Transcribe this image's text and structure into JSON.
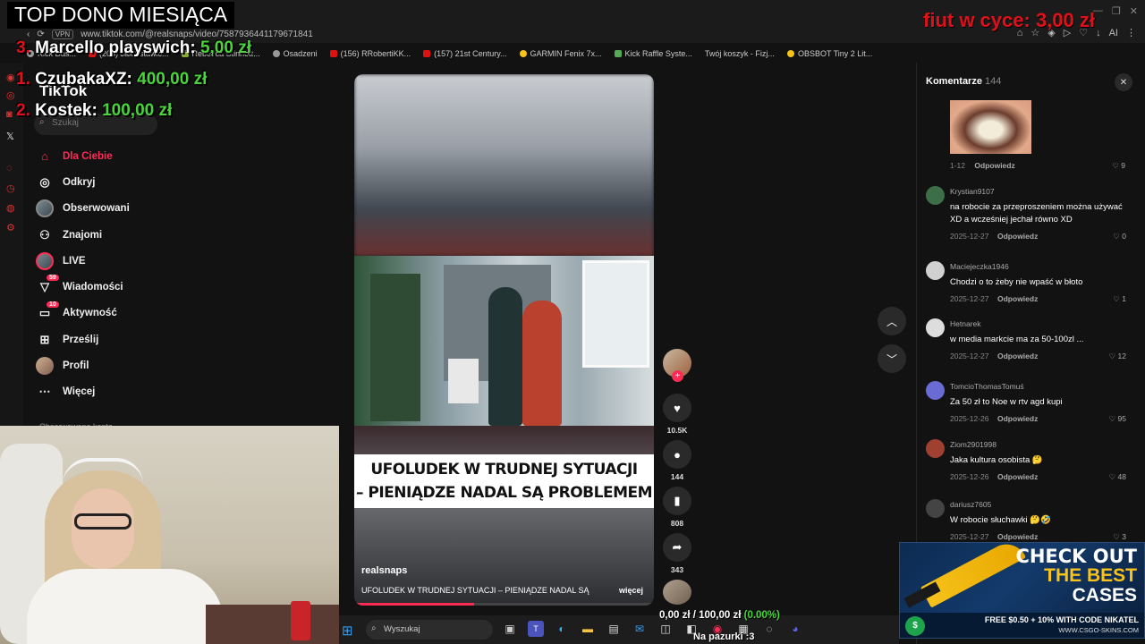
{
  "browser": {
    "url": "www.tiktok.com/@realsnaps/video/7587936441179671841",
    "vpn_label": "VPN",
    "bookmarks": [
      "Marcello playswich:",
      "Kick Das...",
      "(206) Jak ustawić...",
      "Rebecca Stinnett...",
      "Osadzeni",
      "(156) RRobertiKK...",
      "(157) 21st Century...",
      "GARMIN Fenix 7x...",
      "Kick Raffle Syste...",
      "Twój koszyk - Fizj...",
      "OBSBOT Tiny 2 Lit..."
    ],
    "ai_label": "AI"
  },
  "overlay": {
    "top_title": "TOP DONO MIESIĄCA",
    "donors": [
      {
        "rank": "3.",
        "name": "Marcello playswich:",
        "amount": "5,00 zł"
      },
      {
        "rank": "1.",
        "name": "CzubakaXZ:",
        "amount": "400,00 zł"
      },
      {
        "rank": "2.",
        "name": "Kostek:",
        "amount": "100,00 zł"
      }
    ],
    "goal_title": "fiut w cyce:",
    "goal_amount": "3,00 zł",
    "goal_progress": "0,00 zł / 100,00 zł",
    "goal_percent": "(0.00%)",
    "pazurki": "Na pazurki :3"
  },
  "sidebar": {
    "logo": "TikTok",
    "search_placeholder": "Szukaj",
    "items": [
      {
        "label": "Dla Ciebie",
        "icon": "home-icon",
        "active": true
      },
      {
        "label": "Odkryj",
        "icon": "compass-icon"
      },
      {
        "label": "Obserwowani",
        "icon": "following-avatar-icon"
      },
      {
        "label": "Znajomi",
        "icon": "friends-icon"
      },
      {
        "label": "LIVE",
        "icon": "live-avatar-icon"
      },
      {
        "label": "Wiadomości",
        "icon": "messages-icon",
        "badge": "59"
      },
      {
        "label": "Aktywność",
        "icon": "activity-icon",
        "badge": "10"
      },
      {
        "label": "Prześlij",
        "icon": "upload-icon"
      },
      {
        "label": "Profil",
        "icon": "profile-avatar-icon"
      },
      {
        "label": "Więcej",
        "icon": "more-icon"
      }
    ],
    "followed_accounts_label": "Obserwowane konta"
  },
  "video": {
    "banner_line1": "UFOLUDEK W TRUDNEJ SYTUACJI",
    "banner_line2": "– PIENIĄDZE NADAL SĄ PROBLEMEM",
    "username": "realsnaps",
    "description": "UFOLUDEK W TRUDNEJ SYTUACJI – PIENIĄDZE NADAL SĄ",
    "more": "więcej",
    "likes": "10.5K",
    "comments": "144",
    "saves": "808",
    "shares": "343"
  },
  "comments": {
    "title": "Komentarze",
    "count": "144",
    "top_item": {
      "date": "1-12",
      "reply": "Odpowiedz",
      "likes": "9"
    },
    "items": [
      {
        "user": "Krystian9107",
        "text": "na robocie za przeproszeniem można używać XD a wcześniej jechał równo XD",
        "date": "2025-12-27",
        "reply": "Odpowiedz",
        "likes": "0"
      },
      {
        "user": "Maciejeczka1946",
        "text": "Chodzi o to żeby nie wpaść w błoto",
        "date": "2025-12-27",
        "reply": "Odpowiedz",
        "likes": "1"
      },
      {
        "user": "Hetnarek",
        "text": "w media markcie ma za 50-100zl ...",
        "date": "2025-12-27",
        "reply": "Odpowiedz",
        "likes": "12"
      },
      {
        "user": "TomcioThomasTomuś",
        "text": "Za 50 zł to Noe w rtv agd kupi",
        "date": "2025-12-26",
        "reply": "Odpowiedz",
        "likes": "95"
      },
      {
        "user": "Ziom2901998",
        "text": "Jaka kultura osobista 🤔",
        "date": "2025-12-26",
        "reply": "Odpowiedz",
        "likes": "48"
      },
      {
        "user": "dariusz7605",
        "text": "W robocie słuchawki 🤔🤣",
        "date": "2025-12-27",
        "reply": "Odpowiedz",
        "likes": "3"
      }
    ]
  },
  "taskbar": {
    "search_placeholder": "Wyszukaj"
  },
  "ad": {
    "line1": "CHECK OUT",
    "line2": "THE BEST",
    "line3": "CASES",
    "promo": "FREE $0.50 + 10% WITH CODE NIKATEL",
    "site": "WWW.CSGO-SKINS.COM"
  },
  "colors": {
    "accent": "#fe2c55",
    "donor_amount": "#49d43a",
    "donor_rank": "#e0101a"
  }
}
